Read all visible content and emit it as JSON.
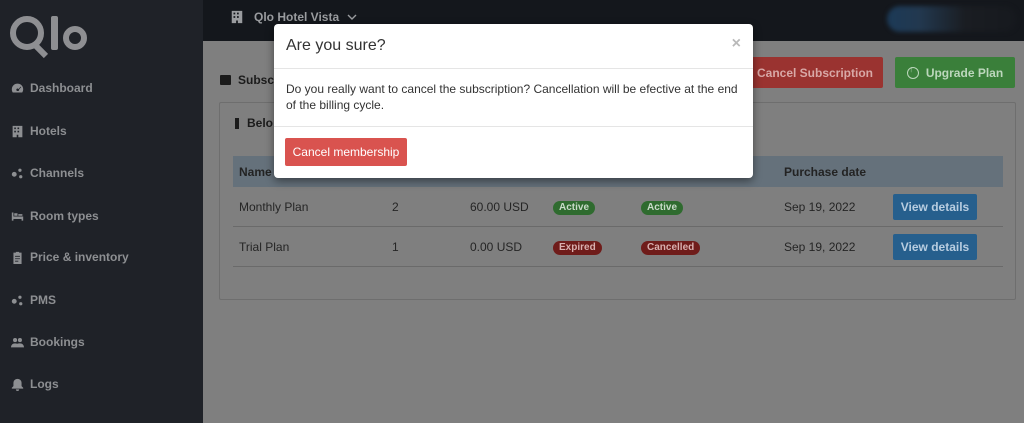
{
  "sidebar": {
    "items": [
      {
        "label": "Dashboard",
        "icon": "dashboard-icon"
      },
      {
        "label": "Hotels",
        "icon": "building-icon"
      },
      {
        "label": "Channels",
        "icon": "channels-icon"
      },
      {
        "label": "Room types",
        "icon": "bed-icon"
      },
      {
        "label": "Price & inventory",
        "icon": "clipboard-icon"
      },
      {
        "label": "PMS",
        "icon": "pms-icon"
      },
      {
        "label": "Bookings",
        "icon": "users-icon"
      },
      {
        "label": "Logs",
        "icon": "bell-icon"
      }
    ]
  },
  "topbar": {
    "hotel_name": "Qlo Hotel Vista"
  },
  "page": {
    "section_label": "Subscr",
    "cancel_subscription_label": "Cancel Subscription",
    "upgrade_plan_label": "Upgrade Plan",
    "panel_title": "Belo"
  },
  "table": {
    "headers": [
      "Name",
      "Purchase date"
    ],
    "rows": [
      {
        "name": "Monthly Plan",
        "qty": "2",
        "price": "60.00 USD",
        "status": "Active",
        "payment": "Active",
        "date": "Sep 19, 2022",
        "action": "View details"
      },
      {
        "name": "Trial Plan",
        "qty": "1",
        "price": "0.00 USD",
        "status": "Expired",
        "payment": "Cancelled",
        "date": "Sep 19, 2022",
        "action": "View details"
      }
    ]
  },
  "modal": {
    "title": "Are you sure?",
    "close": "×",
    "body": "Do you really want to cancel the subscription? Cancellation will be efective at the end of the billing cycle.",
    "confirm_label": "Cancel membership"
  },
  "colors": {
    "sidebar_bg": "#1f2228",
    "danger": "#d9534f",
    "success": "#4cae4c",
    "info": "#337ab7"
  }
}
